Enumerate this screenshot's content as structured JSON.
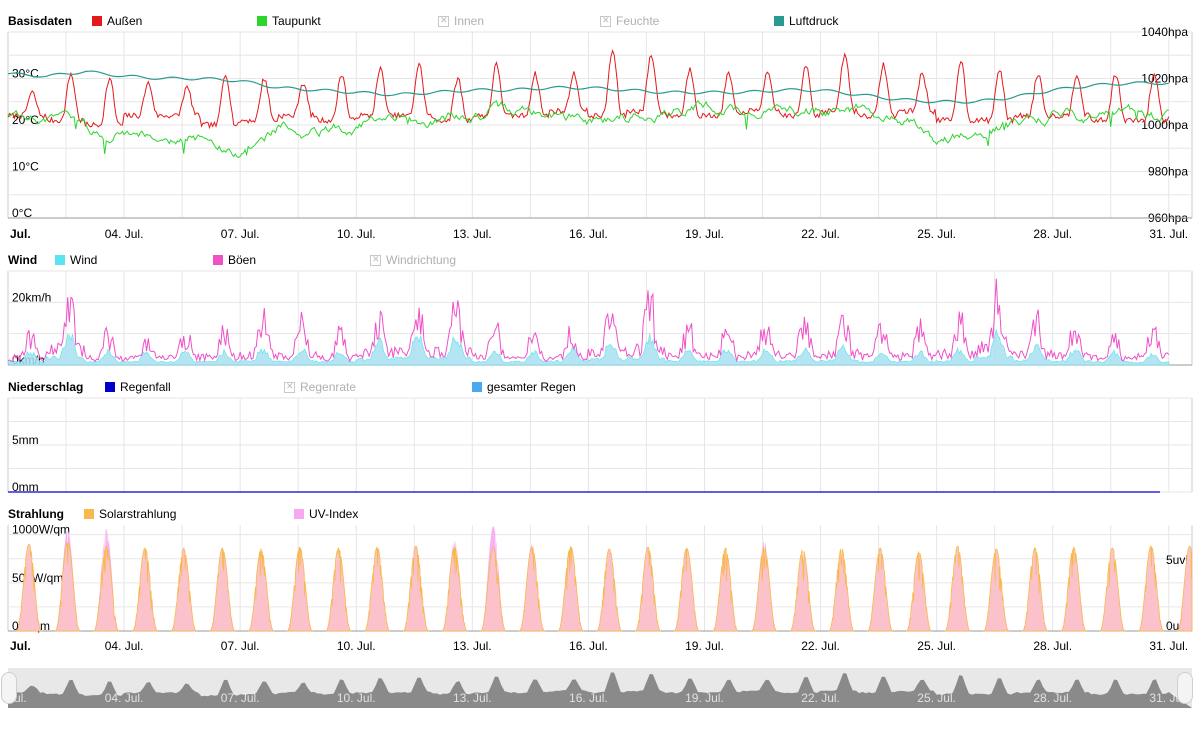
{
  "colors": {
    "aussen": "#e31a1c",
    "taupunkt": "#2ed42e",
    "luftdruck": "#2a9a8e",
    "wind": "#5be3f0",
    "boeen": "#f050c8",
    "regenfall": "#0000cc",
    "gesamter_regen": "#4aa8f0",
    "solar": "#f8b94a",
    "uv": "#f8a8f0",
    "disabled": "#b0b0b0",
    "grid": "#e6e6e6"
  },
  "legends": {
    "basis": {
      "title": "Basisdaten",
      "aussen": "Außen",
      "taupunkt": "Taupunkt",
      "innen": "Innen",
      "feuchte": "Feuchte",
      "luftdruck": "Luftdruck"
    },
    "wind": {
      "title": "Wind",
      "wind": "Wind",
      "boeen": "Böen",
      "richtung": "Windrichtung"
    },
    "rain": {
      "title": "Niederschlag",
      "regenfall": "Regenfall",
      "regenrate": "Regenrate",
      "gesamt": "gesamter Regen"
    },
    "solar": {
      "title": "Strahlung",
      "solar": "Solarstrahlung",
      "uv": "UV-Index"
    }
  },
  "x_axis": {
    "labels": [
      "Jul.",
      "04. Jul.",
      "07. Jul.",
      "10. Jul.",
      "13. Jul.",
      "16. Jul.",
      "19. Jul.",
      "22. Jul.",
      "25. Jul.",
      "28. Jul.",
      "31. Jul."
    ],
    "label_days": [
      1,
      4,
      7,
      10,
      13,
      16,
      19,
      22,
      25,
      28,
      31
    ],
    "range_days": [
      1,
      31.6
    ]
  },
  "chart_data": [
    {
      "type": "line",
      "name": "Basisdaten",
      "x_unit": "day of July",
      "y_left": {
        "ticks": [
          "0°C",
          "10°C",
          "20°C",
          "30°C"
        ],
        "values": [
          0,
          10,
          20,
          30
        ],
        "ylim": [
          0,
          40
        ]
      },
      "y_right": {
        "ticks": [
          "960hpa",
          "980hpa",
          "1000hpa",
          "1020hpa",
          "1040hpa"
        ],
        "values": [
          960,
          980,
          1000,
          1020,
          1040
        ],
        "ylim": [
          960,
          1040
        ]
      },
      "series": [
        {
          "name": "Außen",
          "unit": "°C",
          "daily_min": [
            22,
            21,
            20,
            22,
            22,
            20,
            21,
            22,
            21,
            22,
            22,
            21,
            22,
            22,
            23,
            22,
            23,
            22,
            22,
            23,
            22,
            23,
            22,
            23,
            21,
            21,
            22,
            22,
            21,
            21,
            22
          ],
          "daily_max": [
            27,
            31,
            30,
            29,
            28,
            31,
            30,
            29,
            31,
            32,
            33,
            30,
            33,
            31,
            31,
            36,
            35,
            32,
            31,
            31,
            33,
            35,
            33,
            31,
            34,
            32,
            31,
            31,
            31,
            31,
            27
          ]
        },
        {
          "name": "Taupunkt",
          "unit": "°C",
          "daily_mean": [
            23,
            21,
            19,
            19,
            18,
            17,
            13,
            20,
            19,
            20,
            21,
            21,
            22,
            23,
            22,
            21,
            22,
            23,
            24,
            23,
            23,
            23,
            23,
            22,
            16,
            19,
            20,
            22,
            22,
            22,
            21
          ]
        },
        {
          "name": "Luftdruck",
          "unit": "hpa",
          "daily_mean": [
            1022,
            1021,
            1023,
            1021,
            1020,
            1020,
            1019,
            1016,
            1015,
            1014,
            1013,
            1014,
            1015,
            1015,
            1016,
            1016,
            1015,
            1014,
            1014,
            1014,
            1015,
            1015,
            1013,
            1011,
            1010,
            1010,
            1012,
            1015,
            1017,
            1018,
            1018
          ]
        }
      ]
    },
    {
      "type": "area",
      "name": "Wind",
      "y_left": {
        "ticks": [
          "0km/h",
          "20km/h"
        ],
        "values": [
          0,
          20
        ],
        "ylim": [
          0,
          30
        ]
      },
      "series": [
        {
          "name": "Wind",
          "unit": "km/h",
          "daily_peak": [
            5,
            12,
            5,
            5,
            5,
            5,
            6,
            6,
            5,
            9,
            11,
            11,
            5,
            5,
            6,
            9,
            11,
            6,
            6,
            6,
            6,
            7,
            5,
            5,
            6,
            12,
            7,
            6,
            5,
            4,
            5
          ]
        },
        {
          "name": "Böen",
          "unit": "km/h",
          "daily_peak": [
            13,
            28,
            13,
            12,
            14,
            15,
            19,
            17,
            13,
            22,
            25,
            24,
            17,
            13,
            15,
            22,
            27,
            16,
            16,
            18,
            18,
            20,
            16,
            17,
            20,
            31,
            20,
            16,
            13,
            16,
            14
          ]
        }
      ]
    },
    {
      "type": "line",
      "name": "Niederschlag",
      "y_left": {
        "ticks": [
          "0mm",
          "5mm"
        ],
        "values": [
          0,
          5
        ],
        "ylim": [
          0,
          10
        ]
      },
      "series": [
        {
          "name": "Regenfall",
          "unit": "mm",
          "values": [
            0
          ]
        },
        {
          "name": "gesamter Regen",
          "unit": "mm",
          "values": [
            0
          ]
        }
      ]
    },
    {
      "type": "area",
      "name": "Strahlung",
      "y_left": {
        "ticks": [
          "0W/qm",
          "500W/qm",
          "1000W/qm"
        ],
        "values": [
          0,
          500,
          1000
        ],
        "ylim": [
          0,
          1100
        ]
      },
      "y_right": {
        "ticks": [
          "0uvi",
          "5uvi"
        ],
        "values": [
          0,
          5
        ],
        "ylim": [
          0,
          8
        ]
      },
      "series": [
        {
          "name": "Solarstrahlung",
          "unit": "W/qm",
          "daily_peak": [
            900,
            920,
            880,
            860,
            850,
            860,
            850,
            870,
            860,
            870,
            880,
            870,
            860,
            870,
            880,
            850,
            870,
            860,
            860,
            870,
            850,
            860,
            860,
            820,
            880,
            850,
            860,
            870,
            860,
            880,
            880
          ]
        },
        {
          "name": "UV-Index",
          "unit": "uvi",
          "daily_peak": [
            6,
            7.6,
            7.7,
            6.1,
            6.3,
            6.0,
            6.0,
            6.1,
            5.6,
            6.3,
            6.4,
            6.8,
            7.9,
            6.5,
            6.0,
            6.0,
            6.3,
            6.2,
            6.0,
            6.8,
            6.1,
            6.0,
            5.6,
            6.0,
            5.8,
            5.6,
            5.7,
            5.9,
            5.8,
            5.8,
            5.6
          ]
        }
      ]
    }
  ]
}
